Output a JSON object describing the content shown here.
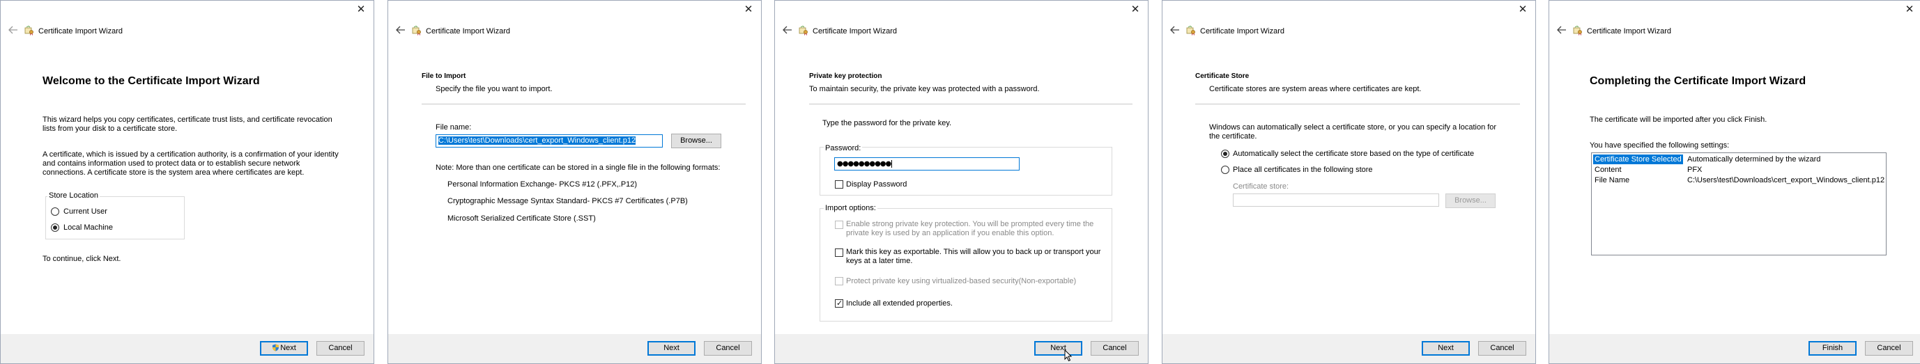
{
  "window": {
    "title": "Certificate Import Wizard"
  },
  "common": {
    "next": "Next",
    "cancel": "Cancel",
    "finish": "Finish",
    "browse": "Browse..."
  },
  "welcome": {
    "heading": "Welcome to the Certificate Import Wizard",
    "para1_l1": "This wizard helps you copy certificates, certificate trust lists, and certificate revocation",
    "para1_l2": "lists from your disk to a certificate store.",
    "para2_l1": "A certificate, which is issued by a certification authority, is a confirmation of your identity",
    "para2_l2": "and contains information used to protect data or to establish secure network",
    "para2_l3": "connections. A certificate store is the system area where certificates are kept.",
    "store_location_label": "Store Location",
    "current_user": "Current User",
    "local_machine": "Local Machine",
    "continue_text": "To continue, click Next."
  },
  "file_to_import": {
    "header_title": "File to Import",
    "header_subtitle": "Specify the file you want to import.",
    "file_name_label": "File name:",
    "file_name_value": "C:\\Users\\test\\Downloads\\cert_export_Windows_client.p12",
    "note_l1": "Note:  More than one certificate can be stored in a single file in the following formats:",
    "format1": "Personal Information Exchange- PKCS #12 (.PFX,.P12)",
    "format2": "Cryptographic Message Syntax Standard- PKCS #7 Certificates (.P7B)",
    "format3": "Microsoft Serialized Certificate Store (.SST)"
  },
  "private_key": {
    "header_title": "Private key protection",
    "header_subtitle": "To maintain security, the private key was protected with a password.",
    "type_password": "Type the password for the private key.",
    "password_label": "Password:",
    "password_value": "●●●●●●●●●●",
    "display_password": "Display Password",
    "import_options": "Import options:",
    "opt1_l1": "Enable strong private key protection. You will be prompted every time the",
    "opt1_l2": "private key is used by an application if you enable this option.",
    "opt2_l1": "Mark this key as exportable. This will allow you to back up or transport your",
    "opt2_l2": "keys at a later time.",
    "opt3": "Protect private key using virtualized-based security(Non-exportable)",
    "opt4": "Include all extended properties."
  },
  "cert_store": {
    "header_title": "Certificate Store",
    "header_subtitle": "Certificate stores are system areas where certificates are kept.",
    "desc_l1": "Windows can automatically select a certificate store, or you can specify a location for",
    "desc_l2": "the certificate.",
    "auto_select": "Automatically select the certificate store based on the type of certificate",
    "place_all": "Place all certificates in the following store",
    "store_label": "Certificate store:"
  },
  "completing": {
    "heading": "Completing the Certificate Import Wizard",
    "line1": "The certificate will be imported after you click Finish.",
    "line2": "You have specified the following settings:",
    "rows": [
      {
        "key": "Certificate Store Selected",
        "value": "Automatically determined by the wizard"
      },
      {
        "key": "Content",
        "value": "PFX"
      },
      {
        "key": "File Name",
        "value": "C:\\Users\\test\\Downloads\\cert_export_Windows_client.p12"
      }
    ]
  },
  "colors": {
    "accent": "#0078d7",
    "footer_bg": "#f0f0f0",
    "button_bg": "#e1e1e1"
  },
  "icons": [
    "close-icon",
    "back-arrow-icon",
    "certificate-wizard-icon",
    "mouse-cursor-icon",
    "shield-icon"
  ]
}
